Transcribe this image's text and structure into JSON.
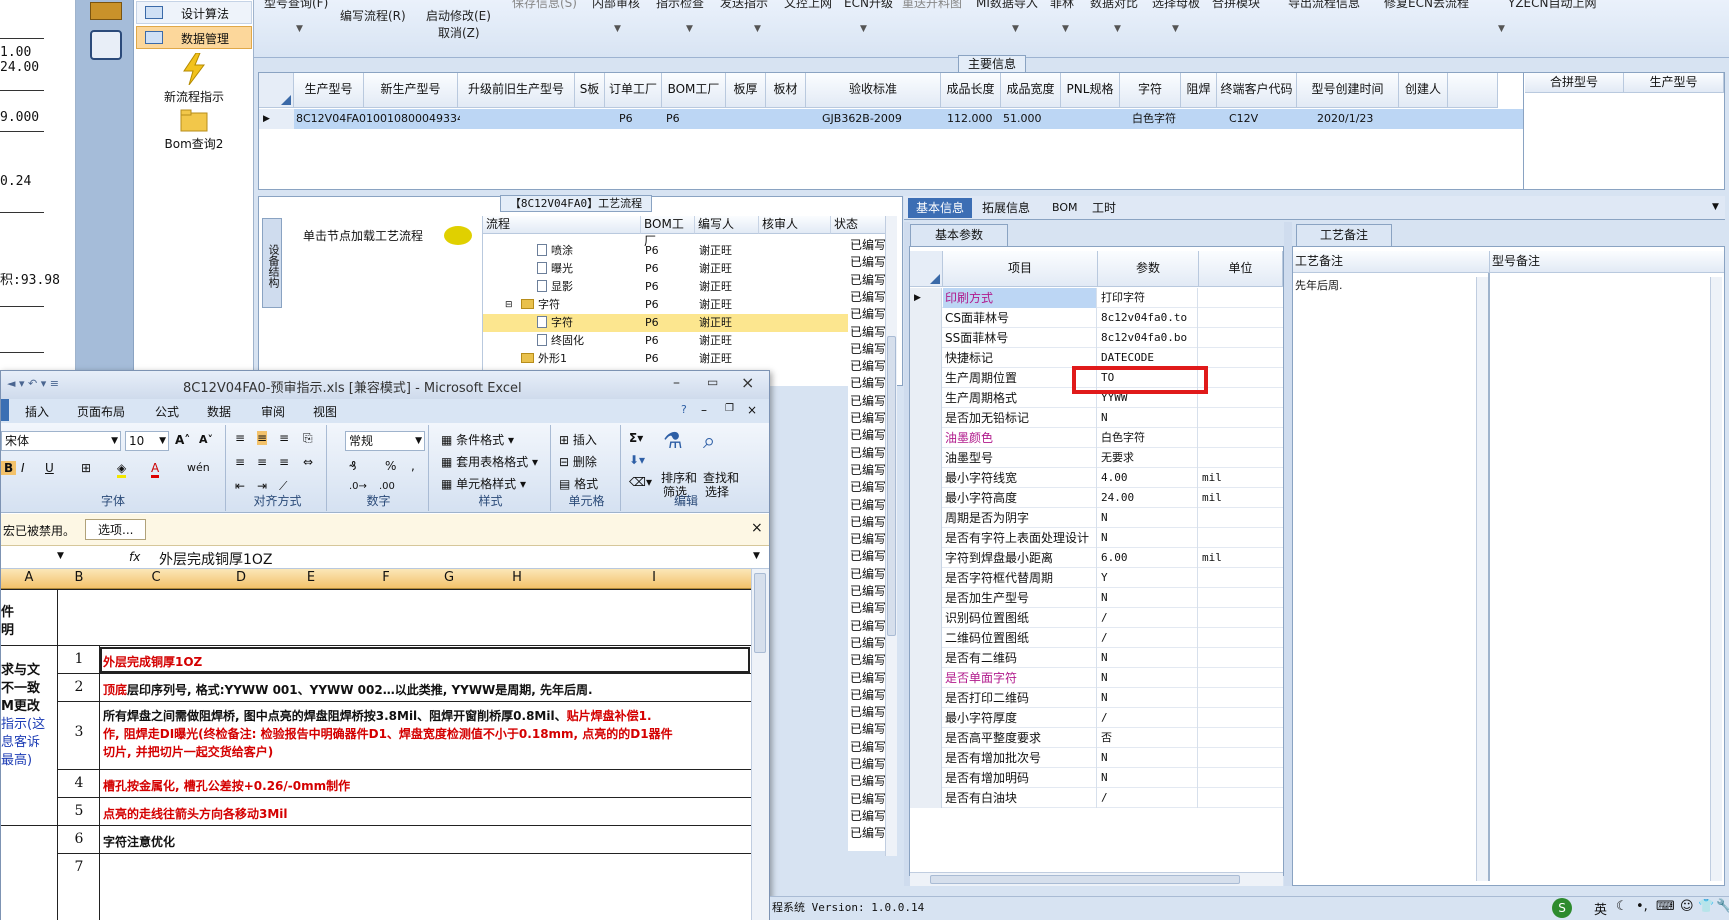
{
  "left_text": {
    "lines": [
      "1.00",
      "24.00",
      "9.000",
      "0.24",
      "积:93.98"
    ]
  },
  "nav": {
    "items": [
      {
        "label": "设计算法"
      },
      {
        "label": "数据管理"
      }
    ],
    "new_flow": "新流程指示",
    "bom_query": "Bom查询2"
  },
  "ribbon": {
    "items": [
      "型号查询(F)",
      "编写流程(R)",
      "启动修改(E)",
      "取消(Z)",
      "保存信息(S)",
      "内部审核",
      "指示检查",
      "发送指示",
      "文控上网",
      "ECN升级",
      "重送开料图",
      "MI数据导入",
      "菲林",
      "数据对比",
      "选择母板",
      "合拼模块",
      "导出流程信息",
      "修复ECN丢流程",
      "YZECN自动上网"
    ]
  },
  "main_info": {
    "label": "主要信息",
    "headers": [
      "生产型号",
      "新生产型号",
      "升级前旧生产型号",
      "S板",
      "订单工厂",
      "BOM工厂",
      "板厚",
      "板材",
      "验收标准",
      "成品长度",
      "成品宽度",
      "PNL规格",
      "字符",
      "阻焊",
      "终端客户代码",
      "型号创建时间",
      "创建人"
    ],
    "row": [
      "8C12V04FA0",
      "10010800049334",
      "",
      "",
      "P6",
      "P6",
      "",
      "",
      "GJB362B-2009",
      "112.000",
      "51.000",
      "",
      "白色字符",
      "",
      "C12V",
      "2020/1/23",
      ""
    ],
    "side_headers": [
      "合拼型号",
      "生产型号"
    ]
  },
  "process": {
    "label": "【8C12V04FA0】工艺流程",
    "vtab": "设备结构",
    "load_hint": "单击节点加载工艺流程",
    "headers": [
      "流程",
      "BOM工厂",
      "编写人",
      "核审人",
      "状态"
    ],
    "rows": [
      {
        "name": "喷涂",
        "factory": "P6",
        "writer": "谢正旺"
      },
      {
        "name": "曝光",
        "factory": "P6",
        "writer": "谢正旺"
      },
      {
        "name": "显影",
        "factory": "P6",
        "writer": "谢正旺"
      },
      {
        "name": "字符",
        "factory": "P6",
        "writer": "谢正旺"
      },
      {
        "name": "字符",
        "factory": "P6",
        "writer": "谢正旺"
      },
      {
        "name": "终固化",
        "factory": "P6",
        "writer": "谢正旺"
      },
      {
        "name": "外形1",
        "factory": "P6",
        "writer": "谢正旺"
      }
    ],
    "status": [
      "已编写",
      "已编写",
      "已编写",
      "已编写",
      "已编写",
      "已编写",
      "已编写",
      "已编写",
      "已编写",
      "已编写",
      "已编写",
      "已编写",
      "已编写",
      "已编写",
      "已编写",
      "已编写",
      "已编写",
      "已编写",
      "已编写",
      "已编写",
      "已编写",
      "已编写",
      "已编写",
      "已编写",
      "已编写",
      "已编写",
      "已编写",
      "已编写",
      "已编写",
      "已编写",
      "已编写",
      "已编写",
      "已编写",
      "已编写",
      "已编写"
    ]
  },
  "details": {
    "tabs": [
      "基本信息",
      "拓展信息",
      "BOM",
      "工时"
    ],
    "basic_tab": "基本参数",
    "headers": [
      "项目",
      "参数",
      "单位"
    ],
    "params": [
      {
        "k": "印刷方式",
        "v": "打印字符",
        "u": "",
        "color": "#b01a8c"
      },
      {
        "k": "CS面菲林号",
        "v": "8c12v04fa0.to",
        "u": ""
      },
      {
        "k": "SS面菲林号",
        "v": "8c12v04fa0.bo",
        "u": ""
      },
      {
        "k": "快捷标记",
        "v": "DATECODE",
        "u": ""
      },
      {
        "k": "生产周期位置",
        "v": "TO",
        "u": ""
      },
      {
        "k": "生产周期格式",
        "v": "YYWW",
        "u": ""
      },
      {
        "k": "是否加无铅标记",
        "v": "N",
        "u": ""
      },
      {
        "k": "油墨颜色",
        "v": "白色字符",
        "u": "",
        "color": "#b01a8c"
      },
      {
        "k": "油墨型号",
        "v": "无要求",
        "u": ""
      },
      {
        "k": "最小字符线宽",
        "v": "4.00",
        "u": "mil"
      },
      {
        "k": "最小字符高度",
        "v": "24.00",
        "u": "mil"
      },
      {
        "k": "周期是否为阴字",
        "v": "N",
        "u": ""
      },
      {
        "k": "是否有字符上表面处理设计",
        "v": "N",
        "u": ""
      },
      {
        "k": "字符到焊盘最小距离",
        "v": "6.00",
        "u": "mil"
      },
      {
        "k": "是否字符框代替周期",
        "v": "Y",
        "u": ""
      },
      {
        "k": "是否加生产型号",
        "v": "N",
        "u": ""
      },
      {
        "k": "识别码位置图纸",
        "v": "/",
        "u": ""
      },
      {
        "k": "二维码位置图纸",
        "v": "/",
        "u": ""
      },
      {
        "k": "是否有二维码",
        "v": "N",
        "u": ""
      },
      {
        "k": "是否单面字符",
        "v": "N",
        "u": "",
        "color": "#b01a8c"
      },
      {
        "k": "是否打印二维码",
        "v": "N",
        "u": ""
      },
      {
        "k": "最小字符厚度",
        "v": "/",
        "u": ""
      },
      {
        "k": "是否高平整度要求",
        "v": "否",
        "u": ""
      },
      {
        "k": "是否有增加批次号",
        "v": "N",
        "u": ""
      },
      {
        "k": "是否有增加明码",
        "v": "N",
        "u": ""
      },
      {
        "k": "是否有白油块",
        "v": "/",
        "u": ""
      }
    ],
    "note_tab": "工艺备注",
    "note_headers": [
      "工艺备注",
      "型号备注"
    ],
    "note_text": "先年后周."
  },
  "excel": {
    "title": "8C12V04FA0-预审指示.xls  [兼容模式] - Microsoft Excel",
    "menu": [
      "插入",
      "页面布局",
      "公式",
      "数据",
      "审阅",
      "视图"
    ],
    "font_name": "宋体",
    "font_size": "10",
    "number_format": "常规",
    "groups": [
      "字体",
      "对齐方式",
      "数字",
      "样式",
      "单元格",
      "编辑"
    ],
    "styles": [
      "条件格式",
      "套用表格格式",
      "单元格样式"
    ],
    "cells_btns": [
      "插入",
      "删除",
      "格式"
    ],
    "edit_btns": [
      "排序和",
      "筛选",
      "查找和",
      "选择"
    ],
    "macro_msg": "宏已被禁用。",
    "macro_btn": "选项...",
    "formula": "外层完成铜厚1OZ",
    "fx": "fx",
    "cols": [
      "A",
      "B",
      "C",
      "D",
      "E",
      "F",
      "G",
      "H",
      "I"
    ],
    "left_labels": [
      "件",
      "明",
      "求与文",
      "不一致",
      "M更改",
      "指示(这",
      "息客诉",
      "最高)"
    ],
    "rows": [
      {
        "n": "1",
        "segments": [
          {
            "t": "外层完成铜厚1OZ",
            "c": "red"
          }
        ]
      },
      {
        "n": "2",
        "segments": [
          {
            "t": "顶底",
            "c": "red"
          },
          {
            "t": "层印序列号, 格式:YYWW 001、YYWW 002…以此类推, YYWW是周期, 先年后周.",
            "c": ""
          }
        ]
      },
      {
        "n": "3",
        "segments": [
          {
            "t": "所有焊盘之间需做阻焊桥, 图中点亮的焊盘阻焊桥按3.8Mil、阻焊开窗削桥厚0.8Mil、",
            "c": ""
          },
          {
            "t": "贴片焊盘补偿1.",
            "c": "red"
          }
        ]
      },
      {
        "n": "",
        "segments": [
          {
            "t": "作, 阻焊走DI曝光(终检备注: 检验报告中明确器件D1、焊盘宽度检测值不小于0.18mm, 点亮的的D1器件",
            "c": "red"
          }
        ]
      },
      {
        "n": "",
        "segments": [
          {
            "t": "切片, 并把切片一起交货给客户)",
            "c": "red"
          }
        ]
      },
      {
        "n": "4",
        "segments": [
          {
            "t": "槽孔按金属化, 槽孔公差按+0.26/-0mm制作",
            "c": "red"
          }
        ]
      },
      {
        "n": "5",
        "segments": [
          {
            "t": "点亮的走线往箭头方向各移动3Mil",
            "c": "red"
          }
        ]
      },
      {
        "n": "6",
        "segments": [
          {
            "t": "字符注意优化",
            "c": ""
          }
        ]
      },
      {
        "n": "7",
        "segments": []
      }
    ]
  },
  "status": {
    "system": "程系统  Version: 1.0.0.14",
    "ime": "英"
  }
}
